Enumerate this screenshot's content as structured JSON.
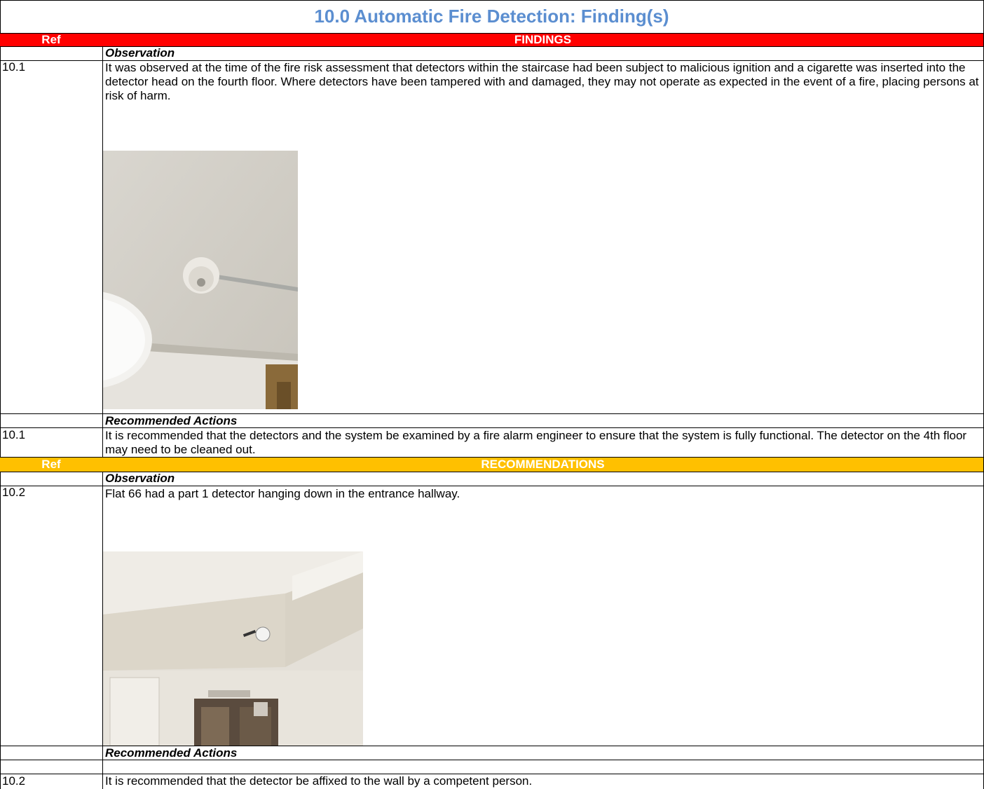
{
  "title": "10.0 Automatic Fire Detection: Finding(s)",
  "findings_band": {
    "ref": "Ref",
    "label": "FINDINGS",
    "color": "#ff0000"
  },
  "recommendations_band": {
    "ref": "Ref",
    "label": "RECOMMENDATIONS",
    "color": "#ffc000"
  },
  "findings": {
    "observation_heading": "Observation",
    "observation_ref": "10.1",
    "observation_text": "It was observed at the time of the fire risk assessment that detectors within the staircase had been subject to malicious ignition and a cigarette was inserted into the detector head on the fourth floor. Where detectors have been tampered with and damaged, they may not operate as expected in the event of a fire, placing persons at risk of harm.",
    "actions_heading": "Recommended Actions",
    "actions_ref": "10.1",
    "actions_text": "It is recommended that the detectors and the system be examined by a fire alarm engineer to ensure that the system is fully functional. The detector on the 4th floor may need to be cleaned out."
  },
  "recommendations": {
    "observation_heading": "Observation",
    "observation_ref": "10.2",
    "observation_text": "Flat 66 had a part 1 detector hanging down in the entrance hallway.",
    "actions_heading": "Recommended Actions",
    "actions_ref": "10.2",
    "actions_text": "It is recommended that the detector be affixed to the wall by a competent person."
  },
  "title_color": "#5b8ed0"
}
